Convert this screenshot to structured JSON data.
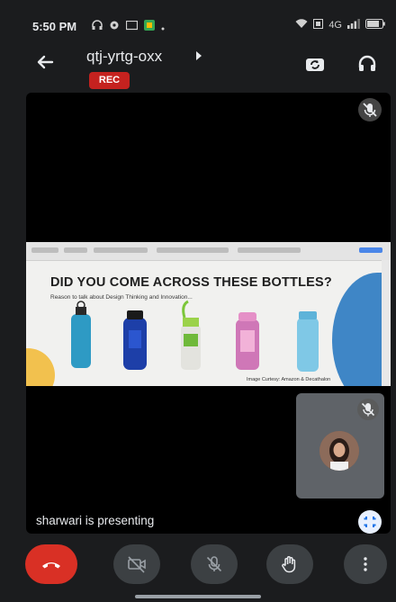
{
  "status_bar": {
    "time": "5:50 PM",
    "right_text": "4G"
  },
  "header": {
    "meeting_code": "qtj-yrtg-oxx",
    "rec_label": "REC"
  },
  "slide": {
    "title": "DID YOU COME ACROSS THESE BOTTLES?",
    "subtitle": "Reason to talk about Design Thinking and Innovation...",
    "credit": "Image Curtesy: Amazon & Decathalon"
  },
  "presenting_text": "sharwari is presenting",
  "colors": {
    "end_call": "#d93025",
    "rec": "#c5221f",
    "control_bg": "#3c4043"
  },
  "controls": [
    "end-call",
    "camera-off",
    "mic-off",
    "raise-hand",
    "more-options"
  ]
}
